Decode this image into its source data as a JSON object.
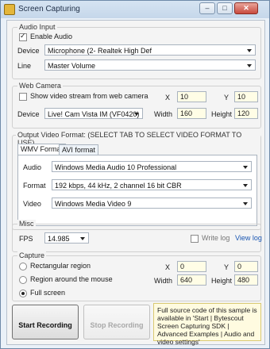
{
  "window": {
    "title": "Screen Capturing",
    "min_label": "–",
    "max_label": "□",
    "close_label": "✕",
    "app_icon": "app-icon"
  },
  "audio_input": {
    "legend": "Audio Input",
    "enable_audio": {
      "label": "Enable Audio",
      "checked": true
    },
    "device_label": "Device",
    "device_value": "Microphone (2- Realtek High Def",
    "line_label": "Line",
    "line_value": "Master Volume"
  },
  "web_camera": {
    "legend": "Web Camera",
    "show_stream": {
      "label": "Show video stream from web camera",
      "checked": false
    },
    "x_label": "X",
    "x_value": "10",
    "y_label": "Y",
    "y_value": "10",
    "device_label": "Device",
    "device_value": "Live! Cam Vista IM (VF0420)",
    "width_label": "Width",
    "width_value": "160",
    "height_label": "Height",
    "height_value": "120"
  },
  "output_format": {
    "legend": "Output Video Format: (SELECT TAB TO SELECT VIDEO FORMAT TO USE)",
    "tabs": [
      "WMV Format",
      "AVI format"
    ],
    "audio_label": "Audio",
    "audio_value": "Windows Media Audio 10 Professional",
    "format_label": "Format",
    "format_value": "192 kbps, 44 kHz, 2 channel 16 bit CBR",
    "video_label": "Video",
    "video_value": "Windows Media Video 9"
  },
  "misc": {
    "legend": "Misc",
    "fps_label": "FPS",
    "fps_value": "14.985",
    "write_log": {
      "label": "Write log",
      "checked": false
    },
    "view_log": "View log"
  },
  "capture": {
    "legend": "Capture",
    "options": [
      {
        "label": "Rectangular region",
        "selected": false
      },
      {
        "label": "Region around the mouse",
        "selected": false
      },
      {
        "label": "Full screen",
        "selected": true
      }
    ],
    "x_label": "X",
    "x_value": "0",
    "y_label": "Y",
    "y_value": "0",
    "width_label": "Width",
    "width_value": "640",
    "height_label": "Height",
    "height_value": "480"
  },
  "buttons": {
    "start": "Start Recording",
    "stop": "Stop Recording"
  },
  "info_text": "Full source code of this sample is available in 'Start | Bytescout Screen Capturing SDK | Advanced Examples | Audio and video settings'",
  "colors": {
    "link": "#1b57b3",
    "info_bg": "#fffbe0",
    "field_bg": "#fffde6"
  }
}
